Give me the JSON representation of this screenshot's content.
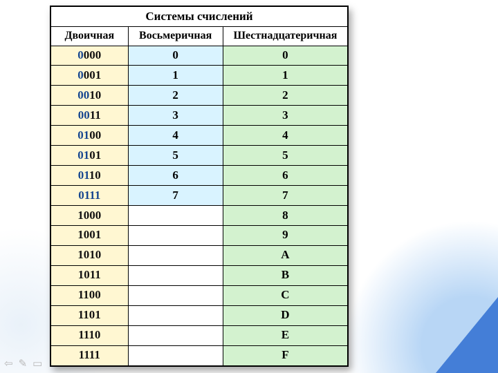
{
  "chart_data": {
    "type": "table",
    "title": "Системы счислений",
    "columns": [
      "Двоичная",
      "Восьмеричная",
      "Шестнадцатеричная"
    ],
    "rows": [
      {
        "bin_prefix": "0",
        "bin_suffix": "000",
        "oct": "0",
        "hex": "0"
      },
      {
        "bin_prefix": "0",
        "bin_suffix": "001",
        "oct": "1",
        "hex": "1"
      },
      {
        "bin_prefix": "00",
        "bin_suffix": "10",
        "oct": "2",
        "hex": "2"
      },
      {
        "bin_prefix": "00",
        "bin_suffix": "11",
        "oct": "3",
        "hex": "3"
      },
      {
        "bin_prefix": "01",
        "bin_suffix": "00",
        "oct": "4",
        "hex": "4"
      },
      {
        "bin_prefix": "01",
        "bin_suffix": "01",
        "oct": "5",
        "hex": "5"
      },
      {
        "bin_prefix": "01",
        "bin_suffix": "10",
        "oct": "6",
        "hex": "6"
      },
      {
        "bin_prefix": "0111",
        "bin_suffix": "",
        "oct": "7",
        "hex": "7"
      },
      {
        "bin_prefix": "",
        "bin_suffix": "1000",
        "oct": "",
        "hex": "8"
      },
      {
        "bin_prefix": "",
        "bin_suffix": "1001",
        "oct": "",
        "hex": "9"
      },
      {
        "bin_prefix": "",
        "bin_suffix": "1010",
        "oct": "",
        "hex": "A"
      },
      {
        "bin_prefix": "",
        "bin_suffix": "1011",
        "oct": "",
        "hex": "B"
      },
      {
        "bin_prefix": "",
        "bin_suffix": "1100",
        "oct": "",
        "hex": "C"
      },
      {
        "bin_prefix": "",
        "bin_suffix": "1101",
        "oct": "",
        "hex": "D"
      },
      {
        "bin_prefix": "",
        "bin_suffix": "1110",
        "oct": "",
        "hex": "E"
      },
      {
        "bin_prefix": "",
        "bin_suffix": "1111",
        "oct": "",
        "hex": "F"
      }
    ]
  },
  "toolbar": {
    "back_icon": "⇦",
    "edit_icon": "✎",
    "view_icon": "▭"
  }
}
